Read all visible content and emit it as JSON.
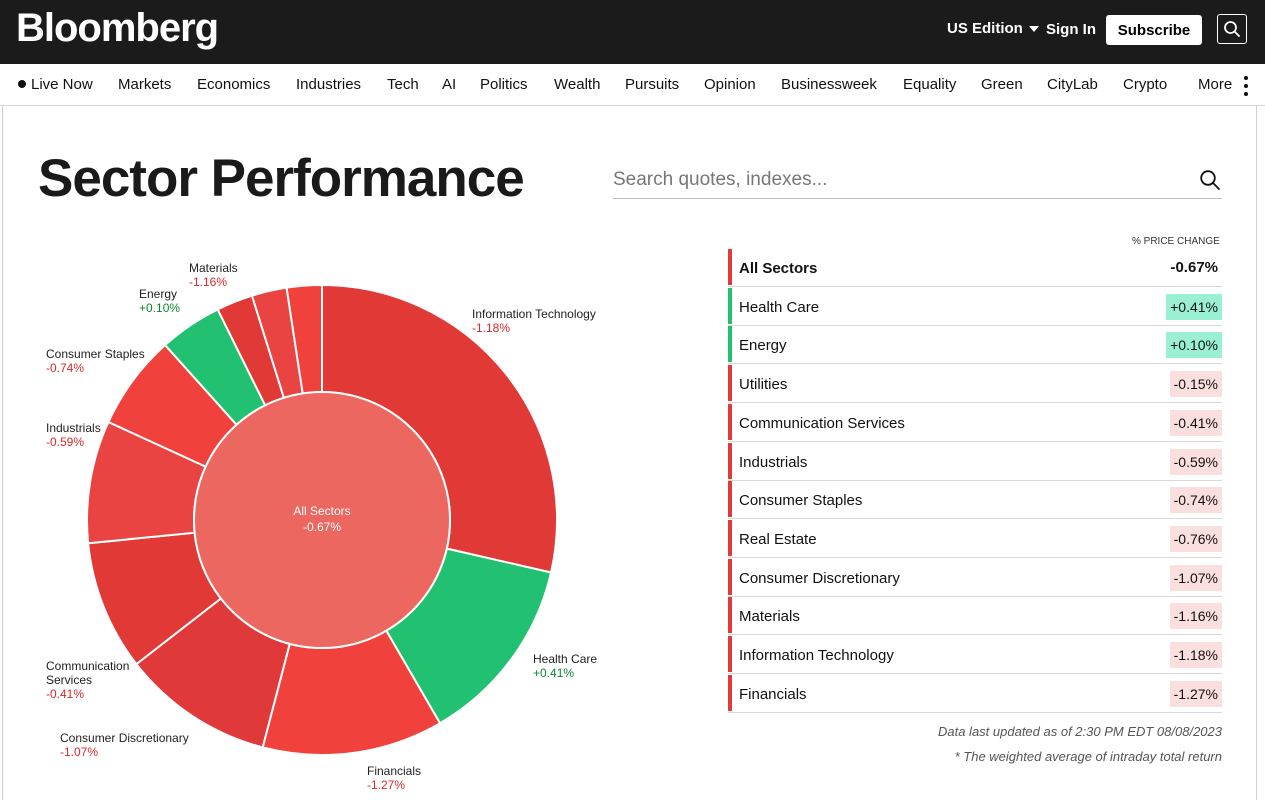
{
  "header": {
    "logo": "Bloomberg",
    "edition": "US Edition",
    "sign_in": "Sign In",
    "subscribe": "Subscribe"
  },
  "nav": {
    "items": [
      "Live Now",
      "Markets",
      "Economics",
      "Industries",
      "Tech",
      "AI",
      "Politics",
      "Wealth",
      "Pursuits",
      "Opinion",
      "Businessweek",
      "Equality",
      "Green",
      "CityLab",
      "Crypto",
      "More"
    ]
  },
  "page": {
    "title": "Sector Performance",
    "search_placeholder": "Search quotes, indexes..."
  },
  "table": {
    "column_header": "% PRICE CHANGE",
    "total": {
      "name": "All Sectors",
      "value": "-0.67%"
    },
    "rows": [
      {
        "name": "Health Care",
        "value": "+0.41%"
      },
      {
        "name": "Energy",
        "value": "+0.10%"
      },
      {
        "name": "Utilities",
        "value": "-0.15%"
      },
      {
        "name": "Communication Services",
        "value": "-0.41%"
      },
      {
        "name": "Industrials",
        "value": "-0.59%"
      },
      {
        "name": "Consumer Staples",
        "value": "-0.74%"
      },
      {
        "name": "Real Estate",
        "value": "-0.76%"
      },
      {
        "name": "Consumer Discretionary",
        "value": "-1.07%"
      },
      {
        "name": "Materials",
        "value": "-1.16%"
      },
      {
        "name": "Information Technology",
        "value": "-1.18%"
      },
      {
        "name": "Financials",
        "value": "-1.27%"
      }
    ]
  },
  "notes": {
    "updated": "Data last updated as of 2:30 PM EDT 08/08/2023",
    "footnote": "* The weighted average of intraday total return"
  },
  "colors": {
    "positive": "#22c071",
    "positive_bg": "#9af0d3",
    "negative": "#e4393b",
    "negative_bg": "#fbdede",
    "center": "#ec6760"
  },
  "chart_data": {
    "type": "pie",
    "center": {
      "label": "All Sectors",
      "value": -0.67,
      "value_label": "-0.67%"
    },
    "segments": [
      {
        "name": "Information Technology",
        "change": -1.18,
        "change_label": "-1.18%",
        "weight": 28.5
      },
      {
        "name": "Health Care",
        "change": 0.41,
        "change_label": "+0.41%",
        "weight": 13.0
      },
      {
        "name": "Financials",
        "change": -1.27,
        "change_label": "-1.27%",
        "weight": 12.4
      },
      {
        "name": "Consumer Discretionary",
        "change": -1.07,
        "change_label": "-1.07%",
        "weight": 10.4
      },
      {
        "name": "Communication Services",
        "change": -0.41,
        "change_label": "-0.41%",
        "weight": 8.9
      },
      {
        "name": "Industrials",
        "change": -0.59,
        "change_label": "-0.59%",
        "weight": 8.4
      },
      {
        "name": "Consumer Staples",
        "change": -0.74,
        "change_label": "-0.74%",
        "weight": 6.5
      },
      {
        "name": "Energy",
        "change": 0.1,
        "change_label": "+0.10%",
        "weight": 4.3
      },
      {
        "name": "Materials",
        "change": -1.16,
        "change_label": "-1.16%",
        "weight": 2.5
      },
      {
        "name": "",
        "change": null,
        "change_label": "",
        "weight": 2.4
      },
      {
        "name": "",
        "change": null,
        "change_label": "",
        "weight": 2.4
      }
    ]
  }
}
